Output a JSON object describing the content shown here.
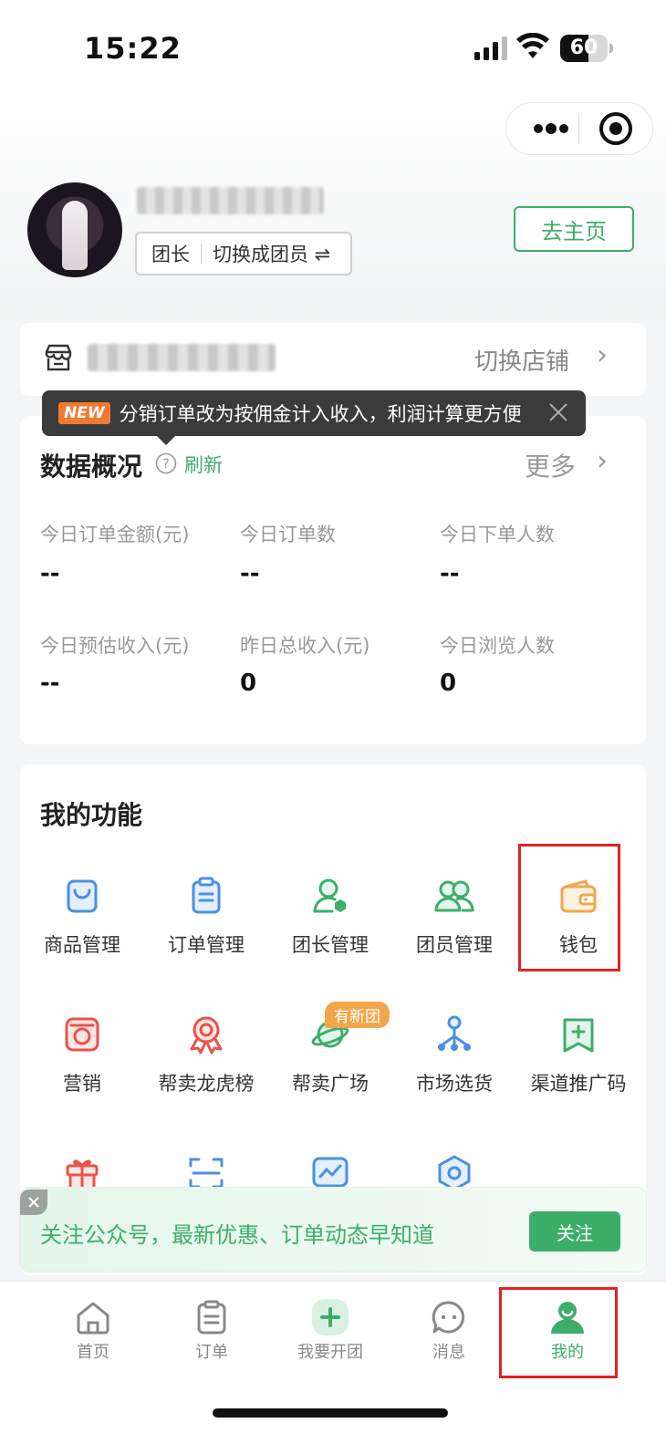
{
  "status_bar": {
    "time": "15:22",
    "battery": "60",
    "battery_level": 0.6
  },
  "profile": {
    "role": "团长",
    "switch_label": "切换成团员 ⇌",
    "home_button": "去主页"
  },
  "store": {
    "switch_label": "切换店铺",
    "chevron": "›"
  },
  "tooltip": {
    "badge": "NEW",
    "message": "分销订单改为按佣金计入收入，利润计算更方便"
  },
  "overview": {
    "title": "数据概况",
    "refresh": "刷新",
    "more": "更多",
    "chevron": "›",
    "stats": [
      {
        "label": "今日订单金额(元)",
        "value": "--"
      },
      {
        "label": "今日订单数",
        "value": "--"
      },
      {
        "label": "今日下单人数",
        "value": "--"
      },
      {
        "label": "今日预估收入(元)",
        "value": "--"
      },
      {
        "label": "昨日总收入(元)",
        "value": "0"
      },
      {
        "label": "今日浏览人数",
        "value": "0"
      }
    ]
  },
  "functions": {
    "title": "我的功能",
    "new_badge": "有新团",
    "items": [
      {
        "label": "商品管理",
        "icon": "bag-icon",
        "color": "#4a90e2"
      },
      {
        "label": "订单管理",
        "icon": "clipboard-icon",
        "color": "#4a90e2"
      },
      {
        "label": "团长管理",
        "icon": "leader-icon",
        "color": "#3dae6a"
      },
      {
        "label": "团员管理",
        "icon": "members-icon",
        "color": "#3dae6a"
      },
      {
        "label": "钱包",
        "icon": "wallet-icon",
        "color": "#f2a64b"
      },
      {
        "label": "营销",
        "icon": "marketing-icon",
        "color": "#e8534a"
      },
      {
        "label": "帮卖龙虎榜",
        "icon": "ribbon-icon",
        "color": "#e8534a"
      },
      {
        "label": "帮卖广场",
        "icon": "planet-icon",
        "color": "#3dae6a"
      },
      {
        "label": "市场选货",
        "icon": "network-icon",
        "color": "#4a90e2"
      },
      {
        "label": "渠道推广码",
        "icon": "bookmark-plus-icon",
        "color": "#3dae6a"
      },
      {
        "label": "",
        "icon": "gift-icon",
        "color": "#e8534a"
      },
      {
        "label": "",
        "icon": "scan-icon",
        "color": "#4a90e2"
      },
      {
        "label": "",
        "icon": "chart-icon",
        "color": "#4a90e2"
      },
      {
        "label": "",
        "icon": "settings-icon",
        "color": "#4a90e2"
      }
    ]
  },
  "follow_banner": {
    "text": "关注公众号，最新优惠、订单动态早知道",
    "button": "关注"
  },
  "tabbar": {
    "items": [
      {
        "label": "首页",
        "icon": "home-icon"
      },
      {
        "label": "订单",
        "icon": "order-icon"
      },
      {
        "label": "我要开团",
        "icon": "plus-icon"
      },
      {
        "label": "消息",
        "icon": "message-icon"
      },
      {
        "label": "我的",
        "icon": "profile-icon",
        "active": true
      }
    ]
  },
  "colors": {
    "brand_green": "#3dae6a",
    "highlight_red": "#e32222"
  }
}
